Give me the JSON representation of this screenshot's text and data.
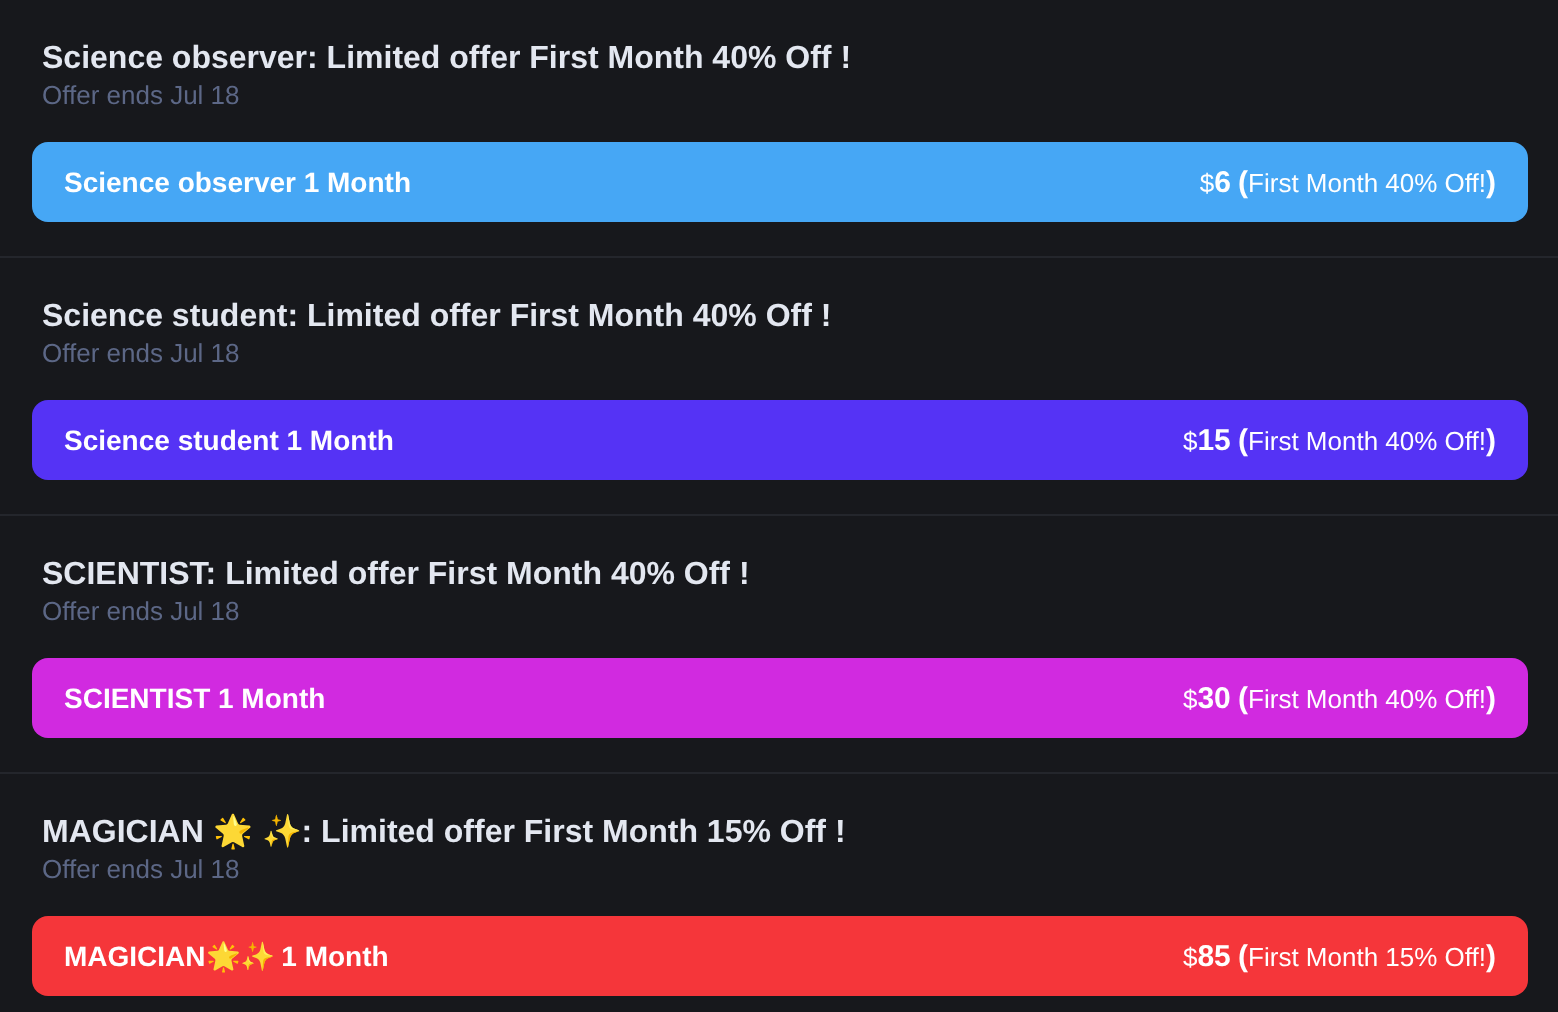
{
  "offers": [
    {
      "title": "Science observer: Limited offer First Month 40% Off !",
      "subtitle": "Offer ends Jul 18",
      "plan": "Science observer 1 Month",
      "price": "$**6** **(**First Month 40% Off!**)**",
      "color": "#46a7f5"
    },
    {
      "title": "Science student: Limited offer First Month 40% Off !",
      "subtitle": "Offer ends Jul 18",
      "plan": "Science student 1 Month",
      "price": "$**15** **(**First Month 40% Off!**)**",
      "color": "#5533f5"
    },
    {
      "title": "SCIENTIST: Limited offer First Month 40% Off !",
      "subtitle": "Offer ends Jul 18",
      "plan": "SCIENTIST 1 Month",
      "price": "$**30** **(**First Month 40% Off!**)**",
      "color": "#d12ae0"
    },
    {
      "title": "MAGICIAN 🌟 ✨: Limited offer First Month 15% Off !",
      "subtitle": "Offer ends Jul 18",
      "plan": "MAGICIAN🌟✨ 1 Month",
      "price": "$**85** **(**First Month 15% Off!**)**",
      "color": "#f5363a"
    }
  ]
}
